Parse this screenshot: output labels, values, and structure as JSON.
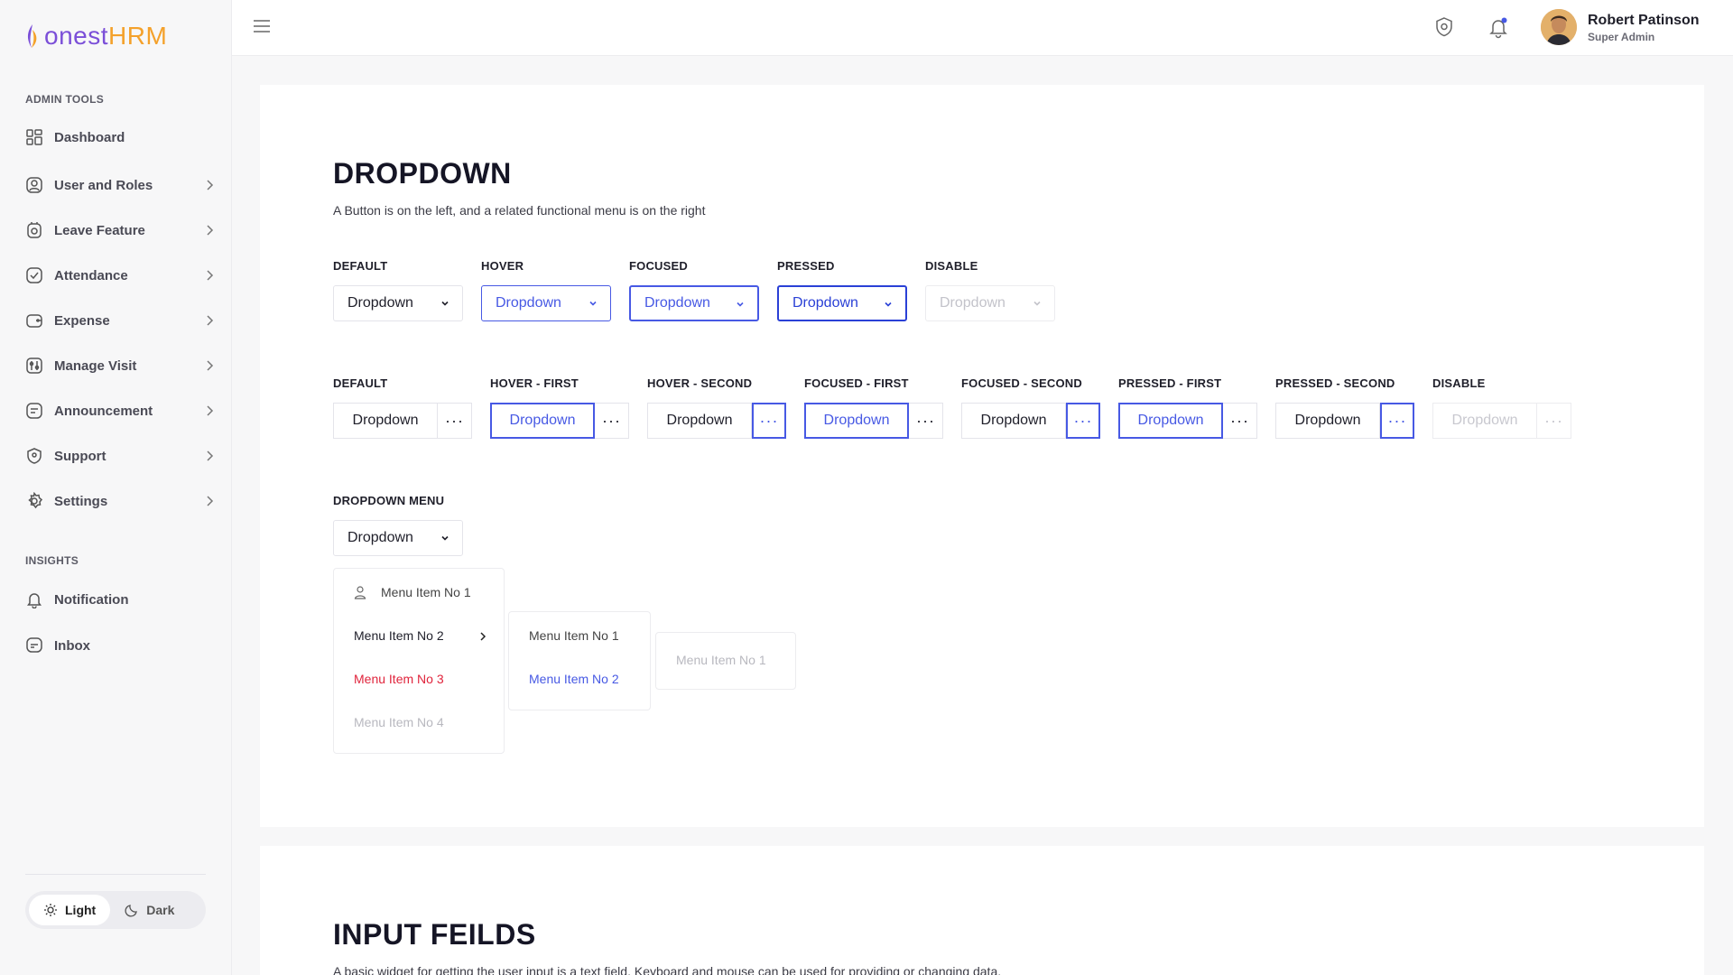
{
  "brand": {
    "part1": "onest",
    "part2": "HRM",
    "color1": "#7b4fd8",
    "color2": "#f4a12b"
  },
  "sidebar": {
    "admin_label": "ADMIN TOOLS",
    "insights_label": "INSIGHTS",
    "items": [
      {
        "label": "Dashboard",
        "icon": "dashboard-icon"
      },
      {
        "label": "User and Roles",
        "icon": "user-roles-icon"
      },
      {
        "label": "Leave Feature",
        "icon": "leave-icon"
      },
      {
        "label": "Attendance",
        "icon": "attendance-icon"
      },
      {
        "label": "Expense",
        "icon": "expense-icon"
      },
      {
        "label": "Manage Visit",
        "icon": "visit-icon"
      },
      {
        "label": "Announcement",
        "icon": "announcement-icon"
      },
      {
        "label": "Support",
        "icon": "support-icon"
      },
      {
        "label": "Settings",
        "icon": "gear-icon"
      }
    ],
    "insights": [
      {
        "label": "Notification",
        "icon": "bell-icon"
      },
      {
        "label": "Inbox",
        "icon": "inbox-icon"
      }
    ],
    "theme": {
      "light": "Light",
      "dark": "Dark",
      "selected": "Light"
    }
  },
  "topbar": {
    "user_name": "Robert Patinson",
    "user_role": "Super Admin"
  },
  "dropdown_section": {
    "title": "DROPDOWN",
    "description": "A Button is on the left, and a related functional menu is on the right",
    "simple_states": [
      {
        "label": "DEFAULT",
        "text": "Dropdown"
      },
      {
        "label": "HOVER",
        "text": "Dropdown"
      },
      {
        "label": "FOCUSED",
        "text": "Dropdown"
      },
      {
        "label": "PRESSED",
        "text": "Dropdown"
      },
      {
        "label": "DISABLE",
        "text": "Dropdown"
      }
    ],
    "split_states": [
      {
        "label": "DEFAULT",
        "text": "Dropdown",
        "more": "···"
      },
      {
        "label": "HOVER - FIRST",
        "text": "Dropdown",
        "more": "···"
      },
      {
        "label": "HOVER - SECOND",
        "text": "Dropdown",
        "more": "···"
      },
      {
        "label": "FOCUSED - FIRST",
        "text": "Dropdown",
        "more": "···"
      },
      {
        "label": "FOCUSED - SECOND",
        "text": "Dropdown",
        "more": "···"
      },
      {
        "label": "PRESSED - FIRST",
        "text": "Dropdown",
        "more": "···"
      },
      {
        "label": "PRESSED - SECOND",
        "text": "Dropdown",
        "more": "···"
      },
      {
        "label": "DISABLE",
        "text": "Dropdown",
        "more": "···"
      }
    ],
    "menu_label": "DROPDOWN MENU",
    "menu_button": "Dropdown",
    "menu1": [
      "Menu Item No 1",
      "Menu Item No 2",
      "Menu Item No 3",
      "Menu Item No 4"
    ],
    "menu2": [
      "Menu Item No 1",
      "Menu Item No 2"
    ],
    "menu3": [
      "Menu Item No 1"
    ]
  },
  "input_section": {
    "title": "INPUT FEILDS",
    "description": "A basic widget for getting the user input is a text field. Keyboard and mouse can be used for providing or changing data."
  },
  "colors": {
    "accent": "#4759e4",
    "danger": "#e0243c",
    "disabled": "#c3c3ca"
  }
}
